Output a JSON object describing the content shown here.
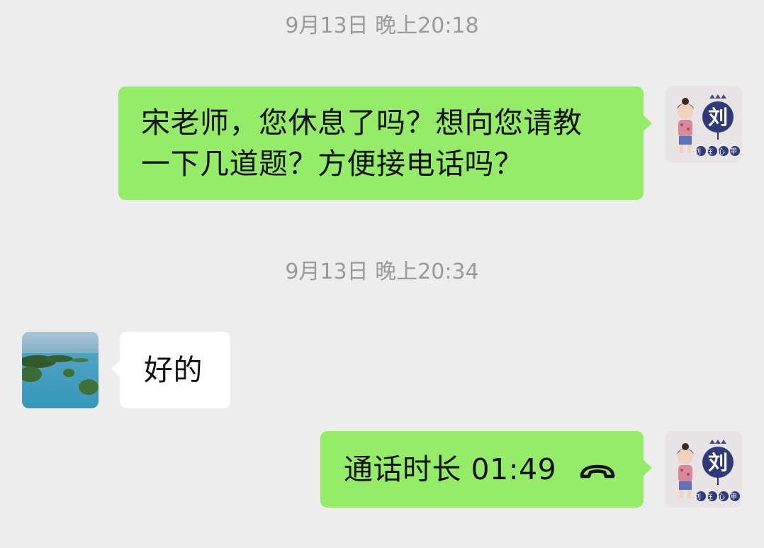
{
  "colors": {
    "background": "#ededed",
    "outgoing_bubble": "#95ec69",
    "incoming_bubble": "#ffffff",
    "timestamp_text": "#9a9a9a"
  },
  "messages": [
    {
      "timestamp": "9月13日 晚上20:18",
      "direction": "outgoing",
      "line1": "宋老师，您休息了吗？想向您请教",
      "line2": "一下几道题？方便接电话吗？"
    },
    {
      "timestamp": "9月13日 晚上20:34",
      "direction": "incoming",
      "text": "好的"
    },
    {
      "direction": "outgoing",
      "type": "voice-call",
      "text": "通话时长 01:49",
      "icon": "phone-hangup-icon"
    }
  ],
  "avatars": {
    "self_avatar_text": "刘",
    "self_avatar_caption": "刘在心甲",
    "contact_avatar": "island-landscape"
  }
}
